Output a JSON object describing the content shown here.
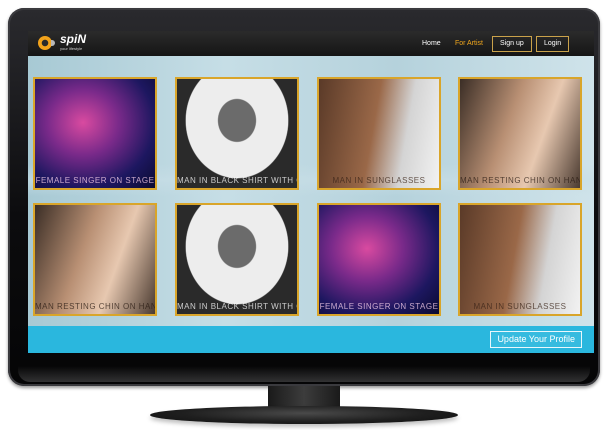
{
  "brand": {
    "name": "spiN",
    "tagline": "your lifestyle"
  },
  "nav": {
    "home": "Home",
    "for_artist": "For Artist",
    "sign_up": "Sign up",
    "login": "Login"
  },
  "gallery": {
    "photos": [
      {
        "subject": "female singer on stage"
      },
      {
        "subject": "man in black shirt with chain"
      },
      {
        "subject": "man in sunglasses"
      },
      {
        "subject": "man resting chin on hands"
      },
      {
        "subject": "man resting chin on hands"
      },
      {
        "subject": "man in black shirt with chain"
      },
      {
        "subject": "female singer on stage"
      },
      {
        "subject": "man in sunglasses"
      }
    ]
  },
  "footer": {
    "update_profile": "Update Your Profile"
  },
  "colors": {
    "accent_orange": "#f0a61c",
    "footer_blue": "#2ab7de",
    "photo_border": "#d9a52a",
    "topbar": "#1e1e1e"
  }
}
